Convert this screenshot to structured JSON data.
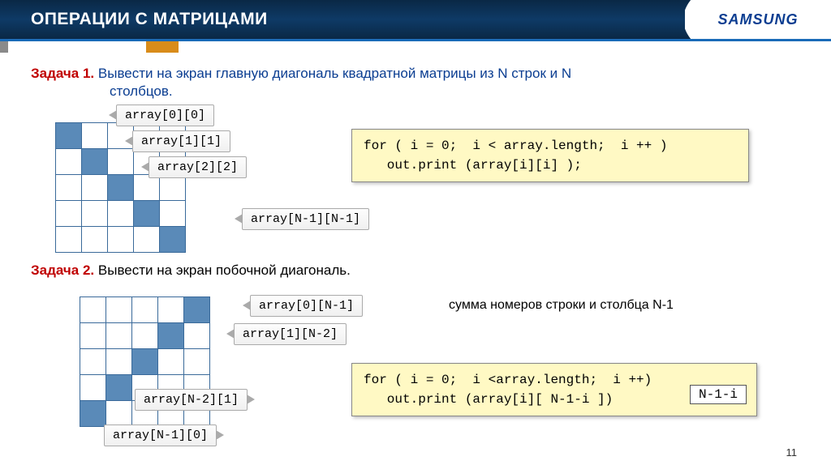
{
  "header": {
    "title": "ОПЕРАЦИИ С МАТРИЦАМИ",
    "logo": "SAMSUNG"
  },
  "task1": {
    "label": "Задача 1.",
    "text": "Вывести на экран главную диагональ квадратной матрицы из N строк и N",
    "text2": "столбцов.",
    "c0": "array[0][0]",
    "c1": "array[1][1]",
    "c2": "array[2][2]",
    "cN": "array[N-1][N-1]",
    "code": "for ( i = 0;  i < array.length;  i ++ )\n   out.print (array[i][i] );"
  },
  "task2": {
    "label": "Задача 2.",
    "text": "Вывести на экран побочной диагональ.",
    "note": "сумма номеров строки и столбца N-1",
    "c0": "array[0][N-1]",
    "c1": "array[1][N-2]",
    "cN2": "array[N-2][1]",
    "cN1": "array[N-1][0]",
    "code": "for ( i = 0;  i <array.length;  i ++)\n   out.print (array[i][ N-1-i ])",
    "hint": "N-1-i"
  },
  "pageNum": "11"
}
